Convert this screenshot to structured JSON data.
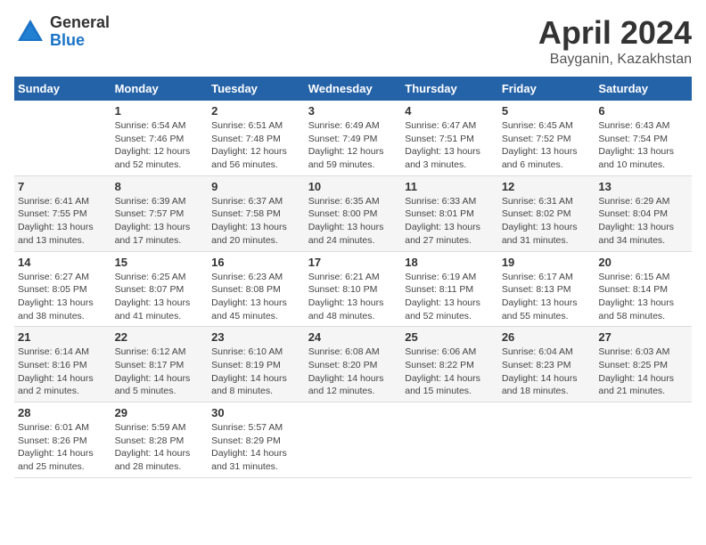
{
  "logo": {
    "general": "General",
    "blue": "Blue"
  },
  "title": "April 2024",
  "subtitle": "Bayganin, Kazakhstan",
  "days_header": [
    "Sunday",
    "Monday",
    "Tuesday",
    "Wednesday",
    "Thursday",
    "Friday",
    "Saturday"
  ],
  "weeks": [
    [
      {
        "day": "",
        "info": ""
      },
      {
        "day": "1",
        "info": "Sunrise: 6:54 AM\nSunset: 7:46 PM\nDaylight: 12 hours\nand 52 minutes."
      },
      {
        "day": "2",
        "info": "Sunrise: 6:51 AM\nSunset: 7:48 PM\nDaylight: 12 hours\nand 56 minutes."
      },
      {
        "day": "3",
        "info": "Sunrise: 6:49 AM\nSunset: 7:49 PM\nDaylight: 12 hours\nand 59 minutes."
      },
      {
        "day": "4",
        "info": "Sunrise: 6:47 AM\nSunset: 7:51 PM\nDaylight: 13 hours\nand 3 minutes."
      },
      {
        "day": "5",
        "info": "Sunrise: 6:45 AM\nSunset: 7:52 PM\nDaylight: 13 hours\nand 6 minutes."
      },
      {
        "day": "6",
        "info": "Sunrise: 6:43 AM\nSunset: 7:54 PM\nDaylight: 13 hours\nand 10 minutes."
      }
    ],
    [
      {
        "day": "7",
        "info": "Sunrise: 6:41 AM\nSunset: 7:55 PM\nDaylight: 13 hours\nand 13 minutes."
      },
      {
        "day": "8",
        "info": "Sunrise: 6:39 AM\nSunset: 7:57 PM\nDaylight: 13 hours\nand 17 minutes."
      },
      {
        "day": "9",
        "info": "Sunrise: 6:37 AM\nSunset: 7:58 PM\nDaylight: 13 hours\nand 20 minutes."
      },
      {
        "day": "10",
        "info": "Sunrise: 6:35 AM\nSunset: 8:00 PM\nDaylight: 13 hours\nand 24 minutes."
      },
      {
        "day": "11",
        "info": "Sunrise: 6:33 AM\nSunset: 8:01 PM\nDaylight: 13 hours\nand 27 minutes."
      },
      {
        "day": "12",
        "info": "Sunrise: 6:31 AM\nSunset: 8:02 PM\nDaylight: 13 hours\nand 31 minutes."
      },
      {
        "day": "13",
        "info": "Sunrise: 6:29 AM\nSunset: 8:04 PM\nDaylight: 13 hours\nand 34 minutes."
      }
    ],
    [
      {
        "day": "14",
        "info": "Sunrise: 6:27 AM\nSunset: 8:05 PM\nDaylight: 13 hours\nand 38 minutes."
      },
      {
        "day": "15",
        "info": "Sunrise: 6:25 AM\nSunset: 8:07 PM\nDaylight: 13 hours\nand 41 minutes."
      },
      {
        "day": "16",
        "info": "Sunrise: 6:23 AM\nSunset: 8:08 PM\nDaylight: 13 hours\nand 45 minutes."
      },
      {
        "day": "17",
        "info": "Sunrise: 6:21 AM\nSunset: 8:10 PM\nDaylight: 13 hours\nand 48 minutes."
      },
      {
        "day": "18",
        "info": "Sunrise: 6:19 AM\nSunset: 8:11 PM\nDaylight: 13 hours\nand 52 minutes."
      },
      {
        "day": "19",
        "info": "Sunrise: 6:17 AM\nSunset: 8:13 PM\nDaylight: 13 hours\nand 55 minutes."
      },
      {
        "day": "20",
        "info": "Sunrise: 6:15 AM\nSunset: 8:14 PM\nDaylight: 13 hours\nand 58 minutes."
      }
    ],
    [
      {
        "day": "21",
        "info": "Sunrise: 6:14 AM\nSunset: 8:16 PM\nDaylight: 14 hours\nand 2 minutes."
      },
      {
        "day": "22",
        "info": "Sunrise: 6:12 AM\nSunset: 8:17 PM\nDaylight: 14 hours\nand 5 minutes."
      },
      {
        "day": "23",
        "info": "Sunrise: 6:10 AM\nSunset: 8:19 PM\nDaylight: 14 hours\nand 8 minutes."
      },
      {
        "day": "24",
        "info": "Sunrise: 6:08 AM\nSunset: 8:20 PM\nDaylight: 14 hours\nand 12 minutes."
      },
      {
        "day": "25",
        "info": "Sunrise: 6:06 AM\nSunset: 8:22 PM\nDaylight: 14 hours\nand 15 minutes."
      },
      {
        "day": "26",
        "info": "Sunrise: 6:04 AM\nSunset: 8:23 PM\nDaylight: 14 hours\nand 18 minutes."
      },
      {
        "day": "27",
        "info": "Sunrise: 6:03 AM\nSunset: 8:25 PM\nDaylight: 14 hours\nand 21 minutes."
      }
    ],
    [
      {
        "day": "28",
        "info": "Sunrise: 6:01 AM\nSunset: 8:26 PM\nDaylight: 14 hours\nand 25 minutes."
      },
      {
        "day": "29",
        "info": "Sunrise: 5:59 AM\nSunset: 8:28 PM\nDaylight: 14 hours\nand 28 minutes."
      },
      {
        "day": "30",
        "info": "Sunrise: 5:57 AM\nSunset: 8:29 PM\nDaylight: 14 hours\nand 31 minutes."
      },
      {
        "day": "",
        "info": ""
      },
      {
        "day": "",
        "info": ""
      },
      {
        "day": "",
        "info": ""
      },
      {
        "day": "",
        "info": ""
      }
    ]
  ]
}
